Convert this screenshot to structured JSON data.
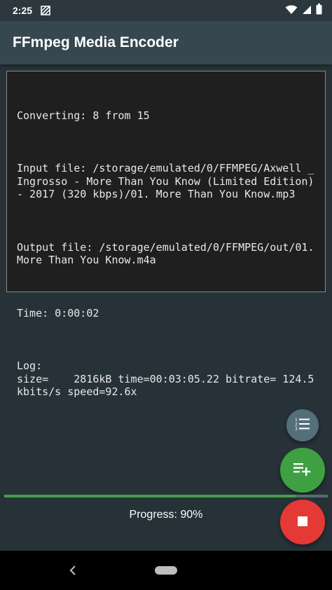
{
  "status_bar": {
    "time": "2:25",
    "icons": [
      "no-sim-icon",
      "wifi-icon",
      "signal-icon",
      "battery-icon"
    ]
  },
  "app_bar": {
    "title": "FFmpeg Media Encoder"
  },
  "console": {
    "converting": "Converting: 8 from 15",
    "input_file": "Input file: /storage/emulated/0/FFMPEG/Axwell _ Ingrosso - More Than You Know (Limited Edition) - 2017 (320 kbps)/01. More Than You Know.mp3",
    "output_file": "Output file: /storage/emulated/0/FFMPEG/out/01. More Than You Know.m4a",
    "time": "Time: 0:00:02",
    "log_label": "Log:",
    "log_line": "size=    2816kB time=00:03:05.22 bitrate= 124.5kbits/s speed=92.6x"
  },
  "progress": {
    "value": 0.9,
    "label": "Progress: 90%"
  },
  "fabs": {
    "list_icon": "format-list-numbered-icon",
    "add_icon": "playlist-add-icon",
    "stop_icon": "stop-icon"
  },
  "colors": {
    "background": "#263238",
    "app_bar": "#37474f",
    "accent_green": "#43a047",
    "stop_red": "#e53935"
  }
}
